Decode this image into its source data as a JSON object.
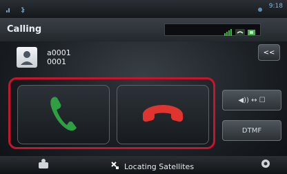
{
  "status_bar": {
    "time": "9:18",
    "icons": [
      "signal-icon",
      "bluetooth-icon",
      "satellite-icon"
    ]
  },
  "header": {
    "title": "Calling"
  },
  "contact": {
    "name": "a0001",
    "number": "0001",
    "back_label": "<<"
  },
  "call_controls": {
    "answer_icon": "phone-answer-icon",
    "hangup_icon": "phone-hangup-icon"
  },
  "side_controls": {
    "audio_label": "◀)) ↔ ☐",
    "dtmf_label": "DTMF"
  },
  "bottom_bar": {
    "gps_text": "Locating Satellites",
    "gps_icon": "satellite-icon"
  },
  "colors": {
    "highlight": "#c9152b",
    "answer": "#2ea043",
    "hangup": "#e0342f"
  }
}
